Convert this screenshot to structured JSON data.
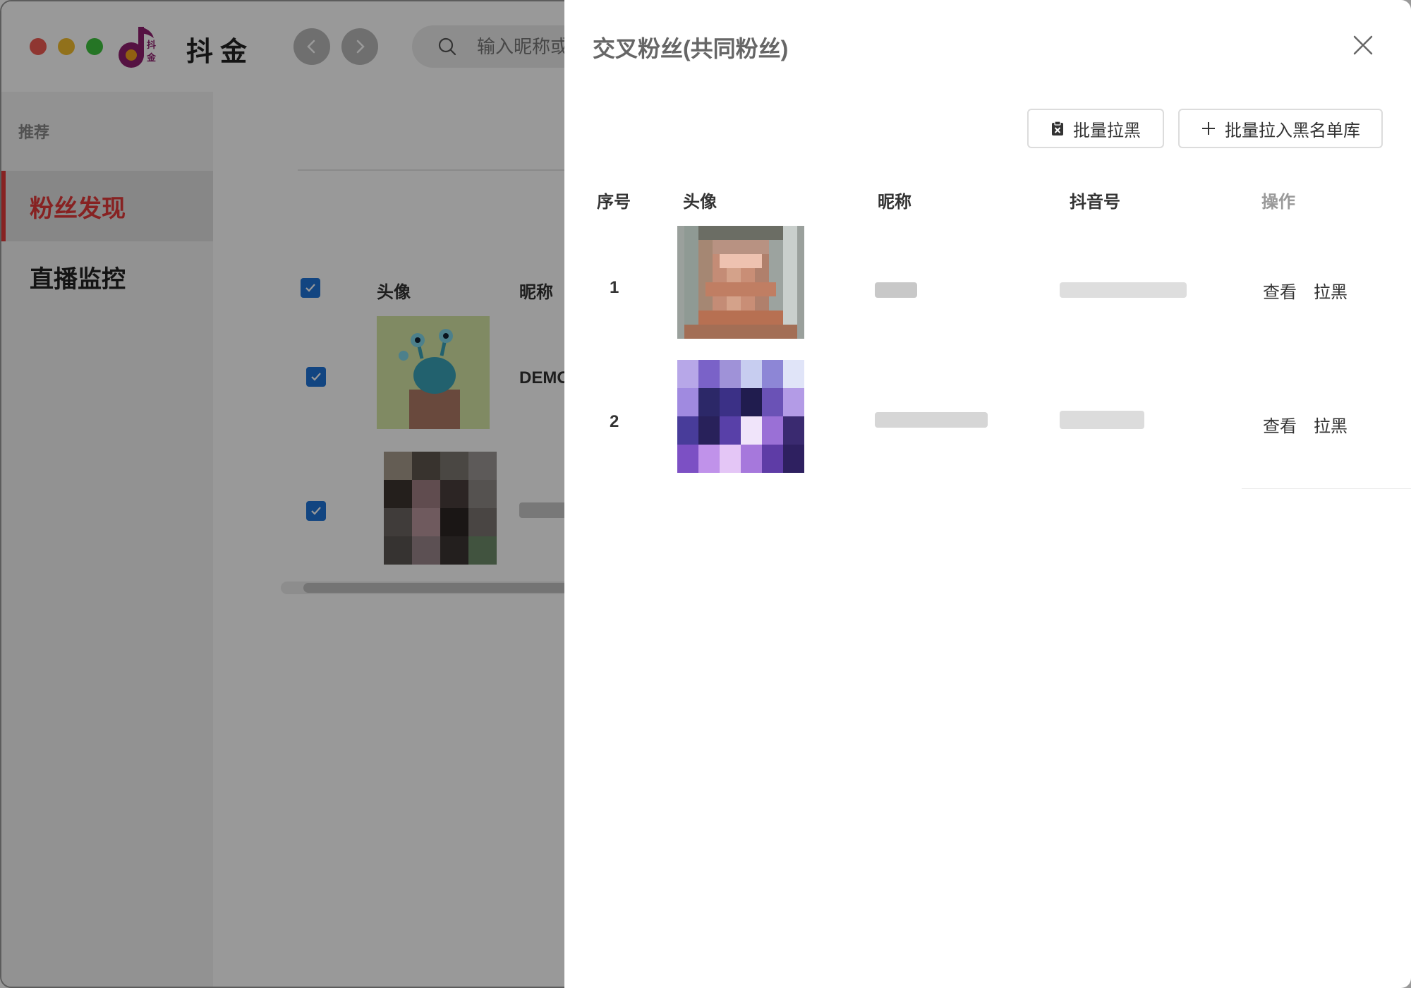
{
  "app": {
    "title": "抖金",
    "logo_text": "抖金",
    "search": {
      "placeholder": "输入昵称或"
    }
  },
  "sidebar": {
    "section_label": "推荐",
    "items": [
      {
        "label": "粉丝发现",
        "active": true
      },
      {
        "label": "直播监控",
        "active": false
      }
    ]
  },
  "background_table": {
    "headers": {
      "avatar": "头像",
      "nickname": "昵称"
    },
    "rows": [
      {
        "checked": true,
        "nickname": "DEMO"
      },
      {
        "checked": true,
        "nickname": ""
      }
    ]
  },
  "drawer": {
    "title": "交叉粉丝(共同粉丝)",
    "toolbar": {
      "batch_block_label": "批量拉黑",
      "batch_blacklist_label": "批量拉入黑名单库"
    },
    "table": {
      "headers": {
        "index": "序号",
        "avatar": "头像",
        "nickname": "昵称",
        "douyin_id": "抖音号",
        "actions": "操作"
      },
      "rows": [
        {
          "index": "1",
          "view_label": "查看",
          "block_label": "拉黑"
        },
        {
          "index": "2",
          "view_label": "查看",
          "block_label": "拉黑"
        }
      ]
    }
  },
  "colors": {
    "accent_red": "#e23a3a",
    "checkbox_blue": "#1f73d8",
    "overlay": "rgba(0,0,0,0.4)"
  },
  "icons": {
    "close": "close-icon",
    "search": "search-icon",
    "back": "chevron-left-icon",
    "forward": "chevron-right-icon",
    "batch_block": "clipboard-x-icon",
    "batch_blacklist": "plus-icon"
  }
}
